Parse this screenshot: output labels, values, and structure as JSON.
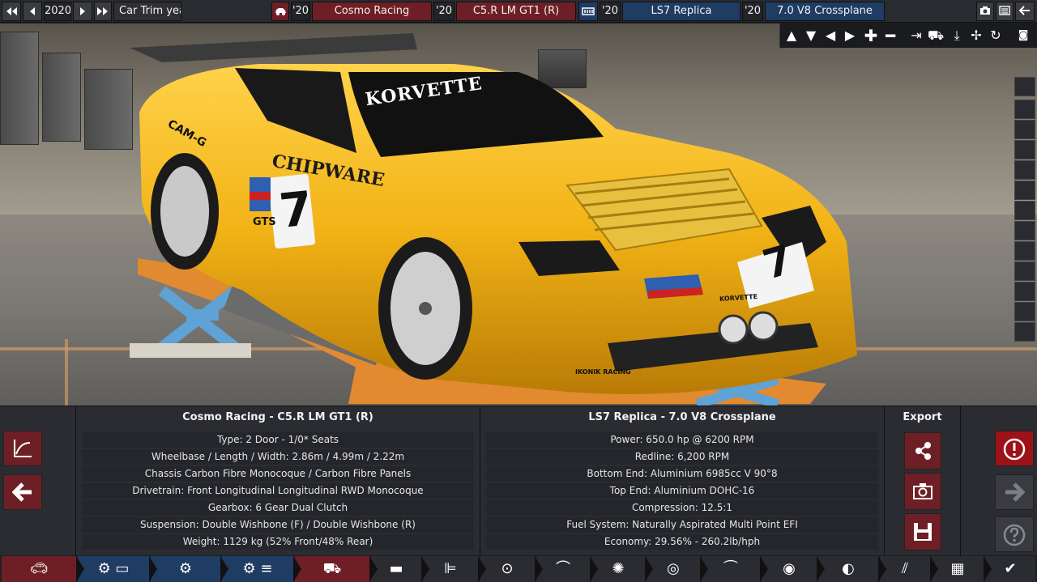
{
  "topbar": {
    "year": "2020",
    "trim_label": "Car Trim year",
    "car_year": "'20",
    "car_family": "Cosmo Racing",
    "car_year2": "'20",
    "car_trim": "C5.R LM GT1 (R)",
    "engine_year": "'20",
    "engine_family": "LS7 Replica",
    "engine_year2": "'20",
    "engine_variant": "7.0 V8 Crossplane"
  },
  "car_specs": {
    "title": "Cosmo Racing - C5.R LM GT1 (R)",
    "rows": [
      "Type: 2 Door - 1/0* Seats",
      "Wheelbase / Length / Width: 2.86m / 4.99m / 2.22m",
      "Chassis Carbon Fibre Monocoque / Carbon Fibre Panels",
      "Drivetrain: Front Longitudinal Longitudinal RWD Monocoque",
      "Gearbox: 6 Gear Dual Clutch",
      "Suspension: Double Wishbone (F) / Double Wishbone (R)",
      "Weight: 1129 kg (52% Front/48% Rear)"
    ]
  },
  "engine_specs": {
    "title": "LS7 Replica - 7.0 V8 Crossplane",
    "rows": [
      "Power: 650.0 hp @ 6200 RPM",
      "Redline:  6,200 RPM",
      "Bottom End: Aluminium 6985cc V 90°8",
      "Top End: Aluminium DOHC-16",
      "Compression: 12.5:1",
      "Fuel System: Naturally Aspirated Multi Point EFI",
      "Economy: 29.56% - 260.2lb/hph"
    ]
  },
  "export": {
    "title": "Export"
  },
  "car_livery": {
    "brand": "KORVETTE",
    "sponsor": "CHIPWARE",
    "number": "7",
    "side": "CAM-G",
    "gts": "GTS",
    "front_brand": "KORVETTE",
    "ikonik": "IKONIK RACING"
  },
  "colors": {
    "accent_red": "#6e1f26",
    "accent_blue": "#1f3c63",
    "car_yellow": "#f2b316"
  }
}
